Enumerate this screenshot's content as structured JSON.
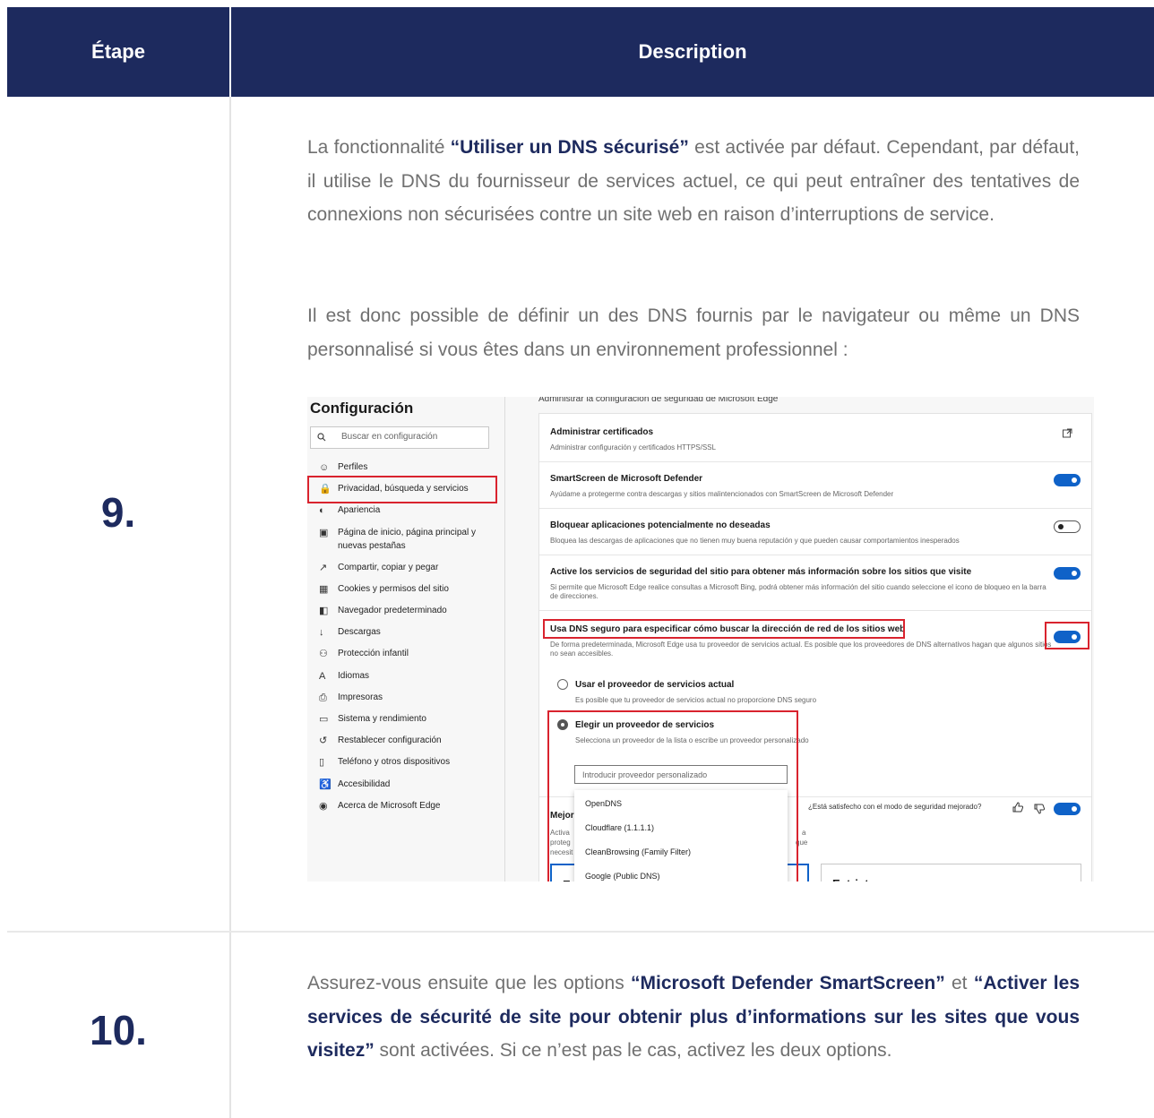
{
  "header": {
    "step": "Étape",
    "description": "Description"
  },
  "rows": [
    {
      "step": "9.",
      "p1": {
        "before": "La fonctionnalité ",
        "bold": "“Utiliser un DNS sécurisé”",
        "after": " est activée par défaut. Cependant, par défaut, il utilise le DNS du fournisseur de services actuel, ce qui peut entraîner des tentatives de connexions non sécurisées contre un site web en raison d’interruptions de service."
      },
      "p2": "Il est donc possible de définir un des DNS fournis par le navigateur ou même un DNS personnalisé si vous êtes dans un environnement professionnel :"
    },
    {
      "step": "10.",
      "p1": {
        "t1": "Assurez-vous ensuite que les options ",
        "b1": "“Microsoft Defender SmartScreen”",
        "t2": " et ",
        "b2": "“Activer les services de sécurité de site pour obtenir plus d’informations sur les sites que vous visitez”",
        "t3": " sont activées. Si ce n’est pas le cas, activez les deux options."
      }
    }
  ],
  "screenshot": {
    "sidebar": {
      "title": "Configuración",
      "search_placeholder": "Buscar en configuración",
      "items": [
        {
          "icon": "profile-icon",
          "glyph": "☺",
          "label": "Perfiles"
        },
        {
          "icon": "lock-icon",
          "glyph": "🔒",
          "label": "Privacidad, búsqueda y servicios"
        },
        {
          "icon": "appearance-icon",
          "glyph": "◐",
          "label": "Apariencia"
        },
        {
          "icon": "home-page-icon",
          "glyph": "▣",
          "label": "Página de inicio, página principal y",
          "label2": "nuevas pestañas"
        },
        {
          "icon": "share-icon",
          "glyph": "↗",
          "label": "Compartir, copiar y pegar"
        },
        {
          "icon": "cookies-icon",
          "glyph": "▦",
          "label": "Cookies y permisos del sitio"
        },
        {
          "icon": "browser-icon",
          "glyph": "◧",
          "label": "Navegador predeterminado"
        },
        {
          "icon": "download-icon",
          "glyph": "↓",
          "label": "Descargas"
        },
        {
          "icon": "family-icon",
          "glyph": "⚇",
          "label": "Protección infantil"
        },
        {
          "icon": "language-icon",
          "glyph": "A",
          "label": "Idiomas"
        },
        {
          "icon": "printer-icon",
          "glyph": "⎙",
          "label": "Impresoras"
        },
        {
          "icon": "system-icon",
          "glyph": "▭",
          "label": "Sistema y rendimiento"
        },
        {
          "icon": "reset-icon",
          "glyph": "↺",
          "label": "Restablecer configuración"
        },
        {
          "icon": "phone-icon",
          "glyph": "▯",
          "label": "Teléfono y otros dispositivos"
        },
        {
          "icon": "accessibility-icon",
          "glyph": "♿",
          "label": "Accesibilidad"
        },
        {
          "icon": "edge-icon",
          "glyph": "◉",
          "label": "Acerca de Microsoft Edge"
        }
      ]
    },
    "main": {
      "top_text": "Administrar la configuración de seguridad de Microsoft Edge",
      "settings": [
        {
          "title": "Administrar certificados",
          "subtitle": "Administrar configuración y certificados HTTPS/SSL",
          "control": "external"
        },
        {
          "title": "SmartScreen de Microsoft Defender",
          "subtitle": "Ayúdame a protegerme contra descargas y sitios malintencionados con SmartScreen de Microsoft Defender",
          "control": "on"
        },
        {
          "title": "Bloquear aplicaciones potencialmente no deseadas",
          "subtitle": "Bloquea las descargas de aplicaciones que no tienen muy buena reputación y que pueden causar comportamientos inesperados",
          "control": "off"
        },
        {
          "title": "Active los servicios de seguridad del sitio para obtener más información sobre los sitios que visite",
          "subtitle": "Si permite que Microsoft Edge realice consultas a Microsoft Bing, podrá obtener más información del sitio cuando seleccione el icono de bloqueo en la barra de direcciones.",
          "control": "on"
        },
        {
          "title": "Usa DNS seguro para especificar cómo buscar la dirección de red de los sitios web",
          "subtitle": "De forma predeterminada, Microsoft Edge usa tu proveedor de servicios actual. Es posible que los proveedores de DNS alternativos hagan que algunos sitios no sean accesibles.",
          "control": "on"
        }
      ],
      "radio_current": {
        "label": "Usar el proveedor de servicios actual",
        "sub": "Es posible que tu proveedor de servicios actual no proporcione DNS seguro"
      },
      "radio_choose": {
        "label": "Elegir un proveedor de servicios",
        "sub": "Selecciona un proveedor de la lista o escribe un proveedor personalizado"
      },
      "custom_input_placeholder": "Introducir proveedor personalizado",
      "dropdown": [
        "OpenDNS",
        "Cloudflare (1.1.1.1)",
        "CleanBrowsing (Family Filter)",
        "Google (Public DNS)"
      ],
      "bottom": {
        "title_fragment": "Mejor",
        "sub_lines": [
          "Activa",
          "proteg",
          "necesit"
        ],
        "right_fragments": [
          "a",
          "que"
        ],
        "feedback": "¿Está satisfecho con el modo de seguridad mejorado?",
        "tile_left": "Eq",
        "tile_right": "Estricta"
      }
    }
  }
}
